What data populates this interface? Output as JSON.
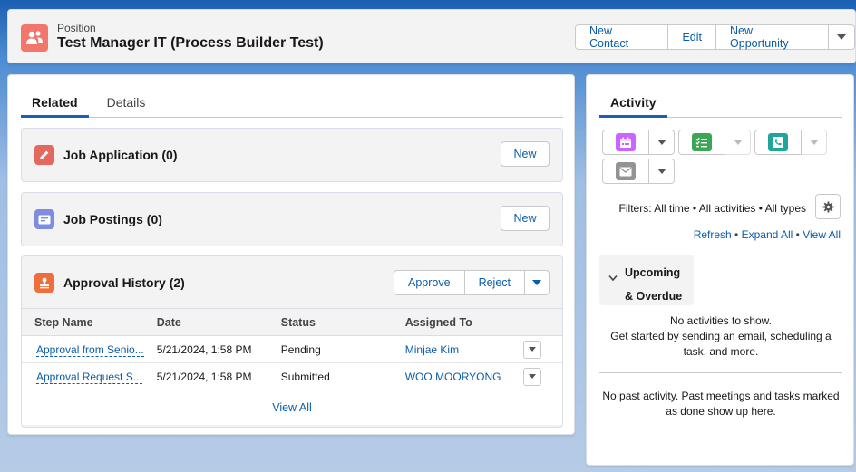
{
  "header": {
    "object_type": "Position",
    "title": "Test Manager IT (Process Builder Test)",
    "actions": [
      "New Contact",
      "Edit",
      "New Opportunity"
    ],
    "icon": "position-icon",
    "icon_color": "#f2766b"
  },
  "tabs": {
    "related": "Related",
    "details": "Details"
  },
  "related_lists": {
    "job_application": {
      "title": "Job Application (0)",
      "button": "New",
      "icon": "pencil-icon",
      "icon_color": "#e5685e"
    },
    "job_postings": {
      "title": "Job Postings (0)",
      "button": "New",
      "icon": "posting-icon",
      "icon_color": "#7f8de1"
    },
    "approval_history": {
      "title": "Approval History (2)",
      "icon": "stamp-icon",
      "icon_color": "#ef6e3b",
      "approve_label": "Approve",
      "reject_label": "Reject",
      "columns": [
        "Step Name",
        "Date",
        "Status",
        "Assigned To"
      ],
      "rows": [
        {
          "step": "Approval from Senio...",
          "date": "5/21/2024, 1:58 PM",
          "status": "Pending",
          "assigned": "Minjae Kim"
        },
        {
          "step": "Approval Request S...",
          "date": "5/21/2024, 1:58 PM",
          "status": "Submitted",
          "assigned": "WOO MOORYONG"
        }
      ],
      "view_all": "View All"
    }
  },
  "activity": {
    "tab": "Activity",
    "buttons": [
      {
        "icon": "calendar-icon",
        "color": "#cb65ff",
        "enabled": true
      },
      {
        "icon": "task-icon",
        "color": "#3ba755",
        "enabled": false
      },
      {
        "icon": "phone-icon",
        "color": "#48c3cc",
        "enabled": false
      },
      {
        "icon": "email-icon",
        "color": "#939393",
        "enabled": true
      }
    ],
    "filters": "Filters: All time • All activities • All types",
    "links": {
      "refresh": "Refresh",
      "expand_all": "Expand All",
      "view_all": "View All",
      "separator": " • "
    },
    "upcoming_line1": "Upcoming",
    "upcoming_line2": "& Overdue",
    "no_activities": "No activities to show.",
    "get_started": "Get started by sending an email, scheduling a task, and more.",
    "no_past": "No past activity. Past meetings and tasks marked as done show up here."
  }
}
